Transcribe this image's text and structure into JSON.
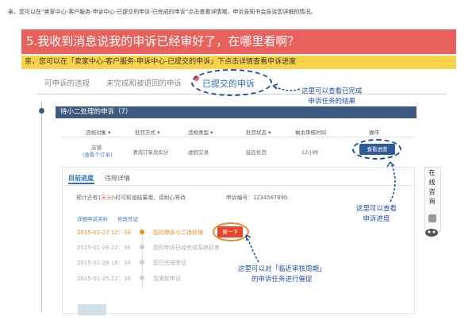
{
  "top_note": "亲，您可以在“卖家中心-客户服务-申诉中心-已提交的申诉-已完成的申诉”点击查看详情哦，申诉告知书会告诉您详细的情况。",
  "banner_title": "5.我收到消息说我的申诉已经审好了，在哪里看啊？",
  "yellow_text": "亲，您可以在「卖家中心-客户服务-申诉中心-已提交的申诉」下点击详情查看申诉进度",
  "tabs": [
    "可申诉的违规",
    "未完成和被退回的申诉",
    "已提交的申诉"
  ],
  "annotations": {
    "a1_line1": "这里可以查看已完成",
    "a1_line2": "申诉任务的结果",
    "a2_line1": "这里可以查看",
    "a2_line2": "申诉进度",
    "a3_line1": "这里可以对「临近审核周期」",
    "a3_line2": "的申诉任务进行催促"
  },
  "pending_bar": "待小二处理的申诉（7）",
  "table": {
    "headers": [
      "违规对象 ▾",
      "处罚方式 ▾",
      "违规类型 ▾",
      "处罚状态 ▾",
      "剩余审核时间",
      "操作"
    ],
    "row": {
      "object_line1": "店铺",
      "object_line2": "(查看个订单)",
      "method": "清洗订单及扣分",
      "type": "虚假交易",
      "status": "延后处罚",
      "remaining": "12小时",
      "action": "查看进度"
    }
  },
  "detail": {
    "tab_progress": "目前进度",
    "tab_detail": "违规详情",
    "estimate_prefix": "预计还有1",
    "estimate_highlight": "天3",
    "estimate_suffix": "小时可知道结果哦，请耐心等待",
    "case_label": "申诉编号：",
    "case_number": "1234567890",
    "link_material": "详细申诉资料",
    "link_edit": "修改凭证",
    "urge_button": "催一下",
    "timeline": [
      {
        "date": "2015-01-27  12：34",
        "text": "您的申诉小二待处理"
      },
      {
        "date": "2015-01-26  22：36",
        "text": "您的申诉已经完成系统初审"
      },
      {
        "date": "2015-01-26  18：34",
        "text": "您已完成举证"
      },
      {
        "date": "2015-01-25  22：36",
        "text": "您发起申诉"
      }
    ]
  },
  "side_widget": [
    "在",
    "线",
    "咨",
    "询"
  ],
  "colors": {
    "banner": "#e9615d",
    "highlight": "#f9d34a",
    "ink": "#1f4fa4",
    "dark_bar": "#3d5a80",
    "orange": "#f08a24"
  }
}
